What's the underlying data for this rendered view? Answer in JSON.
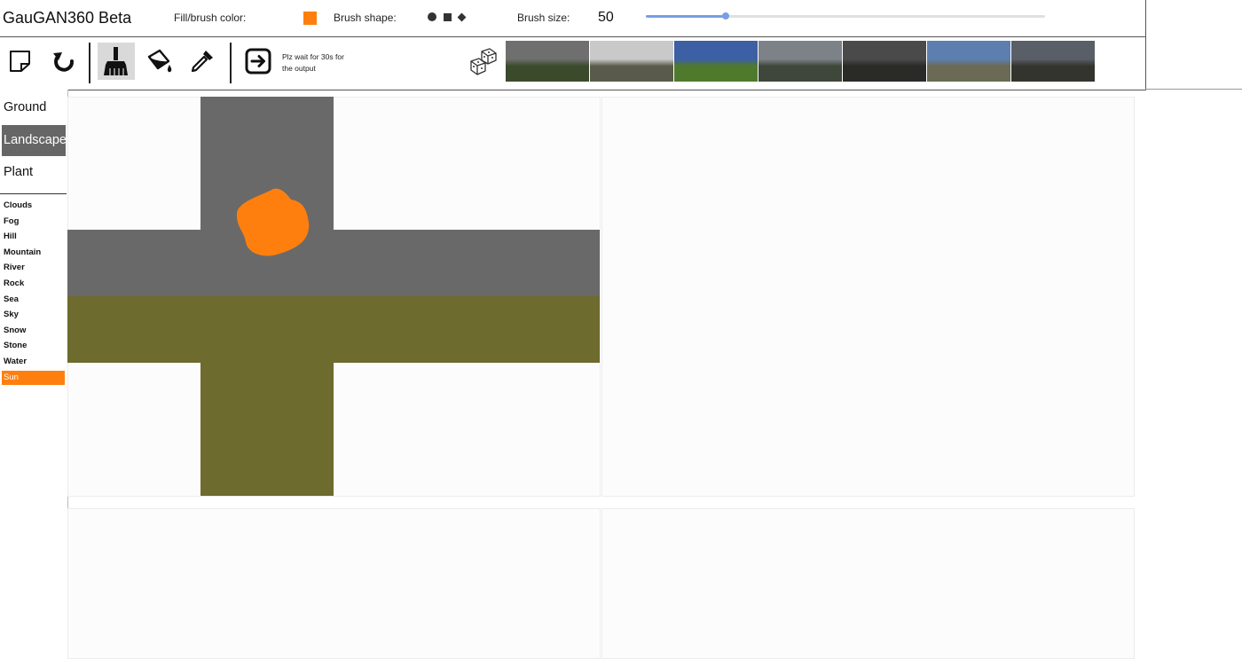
{
  "header": {
    "title": "GauGAN360 Beta",
    "fill_color_label": "Fill/brush color:",
    "fill_color": "#ff7f0e",
    "brush_shape_label": "Brush shape:",
    "brush_shapes": [
      "circle",
      "square",
      "diamond"
    ],
    "brush_size_label": "Brush size:",
    "brush_size": "50",
    "brush_size_fraction": 0.2
  },
  "toolbar": {
    "tools": [
      {
        "name": "new-canvas-icon"
      },
      {
        "name": "undo-icon"
      },
      {
        "name": "brush-icon",
        "active": true
      },
      {
        "name": "paint-bucket-icon"
      },
      {
        "name": "eyedropper-icon"
      },
      {
        "name": "submit-arrow-icon"
      }
    ],
    "wait_note_line1": "Plz wait for 30s for",
    "wait_note_line2": "the output",
    "random_icon": "cube-dice-icon",
    "example_thumbnails": [
      {
        "sky": "#6f6f6f",
        "ground": "#3a4a2a"
      },
      {
        "sky": "#c9c9c9",
        "ground": "#5a5a4a"
      },
      {
        "sky": "#3d5fa4",
        "ground": "#4f7a2c"
      },
      {
        "sky": "#7d8288",
        "ground": "#3f463a"
      },
      {
        "sky": "#4a4a4a",
        "ground": "#2a2a26"
      },
      {
        "sky": "#5d7fb0",
        "ground": "#6a6a55"
      },
      {
        "sky": "#5a5e66",
        "ground": "#34342f"
      }
    ]
  },
  "palette": {
    "categories": [
      "Ground",
      "Landscape",
      "Plant"
    ],
    "selected_category": "Landscape",
    "items": [
      "Clouds",
      "Fog",
      "Hill",
      "Mountain",
      "River",
      "Rock",
      "Sea",
      "Sky",
      "Snow",
      "Stone",
      "Water",
      "Sun"
    ],
    "selected_item": "Sun"
  },
  "canvas": {
    "sky_color": "#696969",
    "ground_color": "#6d6b2d",
    "sun_color": "#ff7f0e"
  }
}
